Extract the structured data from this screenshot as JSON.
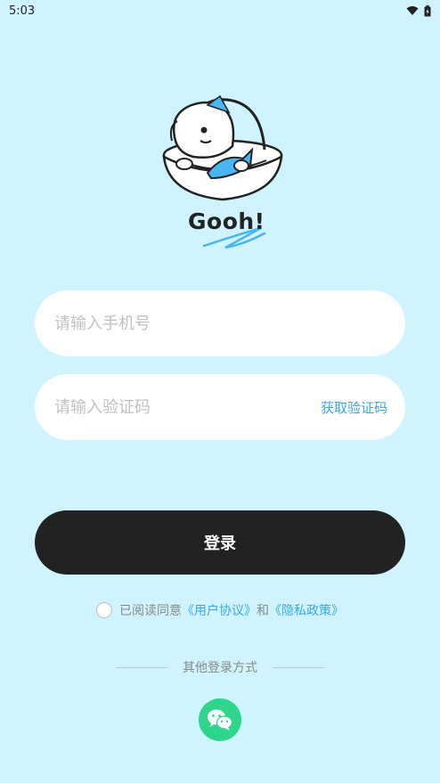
{
  "status": {
    "time": "5:03",
    "icons": [
      "wifi-icon",
      "battery-icon"
    ]
  },
  "logo": {
    "text": "Gooh!"
  },
  "form": {
    "phone_placeholder": "请输入手机号",
    "code_placeholder": "请输入验证码",
    "get_code_label": "获取验证码",
    "login_label": "登录"
  },
  "agreement": {
    "prefix": "已阅读同意",
    "user_agreement": "《用户协议》",
    "conjunction": "和",
    "privacy_policy": "《隐私政策》",
    "checked": false
  },
  "other_login": {
    "label": "其他登录方式",
    "methods": [
      "wechat-icon"
    ]
  },
  "colors": {
    "background": "#cff4ff",
    "accent": "#3aa6e6",
    "button": "#222222",
    "wechat": "#2fd58a"
  }
}
